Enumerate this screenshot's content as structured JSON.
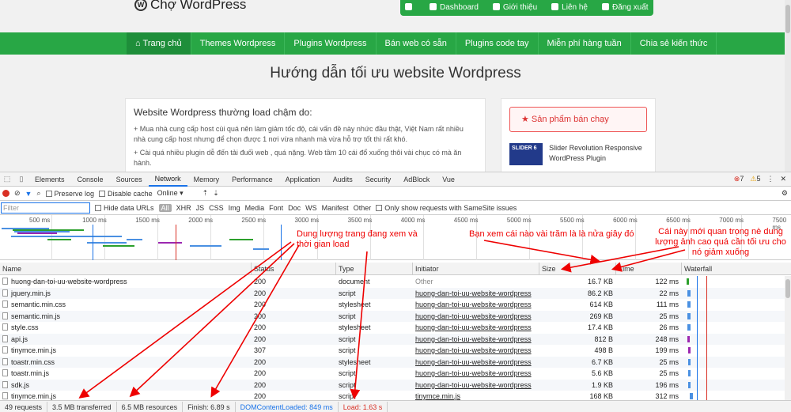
{
  "site": {
    "logo": "Chợ WordPress",
    "topnav": [
      "Dashboard",
      "Giới thiệu",
      "Liên hệ",
      "Đăng xuất"
    ],
    "mainnav": [
      "Trang chủ",
      "Themes Wordpress",
      "Plugins Wordpress",
      "Bán web có sẵn",
      "Plugins code tay",
      "Miễn phí hàng tuần",
      "Chia sẻ kiến thức"
    ],
    "heading": "Hướng dẫn tối ưu website Wordpress",
    "article_title": "Website Wordpress thường load chậm do:",
    "para1": "+ Mua nhà cung cấp host cùi quá nên làm giảm tốc độ, cái vấn đề này nhức đầu thật, Việt Nam rất nhiều nhà cung cấp host nhưng để chọn được 1 nơi vừa nhanh mà vừa hỗ trợ tốt thì rất khó.",
    "para2": "+ Cài quá nhiều plugin dễ đến tải đuối web , quá nặng. Web tầm 10 cái đổ xuống thôi vài chục có mà ăn hành.",
    "best_seller": "Sản phẩm bán chạy",
    "product_thumb": "SLIDER 6",
    "product_name": "Slider Revolution Responsive WordPress Plugin"
  },
  "devtools": {
    "tabs": [
      "Elements",
      "Console",
      "Sources",
      "Network",
      "Memory",
      "Performance",
      "Application",
      "Audits",
      "Security",
      "AdBlock",
      "Vue"
    ],
    "errors": "7",
    "warnings": "5",
    "preserve_log": "Preserve log",
    "disable_cache": "Disable cache",
    "throttle": "Online",
    "filter_placeholder": "Filter",
    "hide_data_urls": "Hide data URLs",
    "types": [
      "All",
      "XHR",
      "JS",
      "CSS",
      "Img",
      "Media",
      "Font",
      "Doc",
      "WS",
      "Manifest",
      "Other"
    ],
    "samesite": "Only show requests with SameSite issues",
    "ticks": [
      "500 ms",
      "1000 ms",
      "1500 ms",
      "2000 ms",
      "2500 ms",
      "3000 ms",
      "3500 ms",
      "4000 ms",
      "4500 ms",
      "5000 ms",
      "5500 ms",
      "6000 ms",
      "6500 ms",
      "7000 ms",
      "7500 ms"
    ],
    "columns": {
      "name": "Name",
      "status": "Status",
      "type": "Type",
      "initiator": "Initiator",
      "size": "Size",
      "time": "Time",
      "waterfall": "Waterfall"
    },
    "rows": [
      {
        "name": "huong-dan-toi-uu-website-wordpress",
        "status": "200",
        "type": "document",
        "initiator": "Other",
        "size": "16.7 KB",
        "time": "122 ms"
      },
      {
        "name": "jquery.min.js",
        "status": "200",
        "type": "script",
        "initiator": "huong-dan-toi-uu-website-wordpress",
        "size": "86.2 KB",
        "time": "22 ms"
      },
      {
        "name": "semantic.min.css",
        "status": "200",
        "type": "stylesheet",
        "initiator": "huong-dan-toi-uu-website-wordpress",
        "size": "614 KB",
        "time": "111 ms"
      },
      {
        "name": "semantic.min.js",
        "status": "200",
        "type": "script",
        "initiator": "huong-dan-toi-uu-website-wordpress",
        "size": "269 KB",
        "time": "25 ms"
      },
      {
        "name": "style.css",
        "status": "200",
        "type": "stylesheet",
        "initiator": "huong-dan-toi-uu-website-wordpress",
        "size": "17.4 KB",
        "time": "26 ms"
      },
      {
        "name": "api.js",
        "status": "200",
        "type": "script",
        "initiator": "huong-dan-toi-uu-website-wordpress",
        "size": "812 B",
        "time": "248 ms"
      },
      {
        "name": "tinymce.min.js",
        "status": "307",
        "type": "script",
        "initiator": "huong-dan-toi-uu-website-wordpress",
        "size": "498 B",
        "time": "199 ms"
      },
      {
        "name": "toastr.min.css",
        "status": "200",
        "type": "stylesheet",
        "initiator": "huong-dan-toi-uu-website-wordpress",
        "size": "6.7 KB",
        "time": "25 ms"
      },
      {
        "name": "toastr.min.js",
        "status": "200",
        "type": "script",
        "initiator": "huong-dan-toi-uu-website-wordpress",
        "size": "5.6 KB",
        "time": "25 ms"
      },
      {
        "name": "sdk.js",
        "status": "200",
        "type": "script",
        "initiator": "huong-dan-toi-uu-website-wordpress",
        "size": "1.9 KB",
        "time": "196 ms"
      },
      {
        "name": "tinymce.min.js",
        "status": "200",
        "type": "script",
        "initiator": "tinymce.min.js",
        "size": "168 KB",
        "time": "312 ms"
      }
    ],
    "status_bar": {
      "requests": "49 requests",
      "transferred": "3.5 MB transferred",
      "resources": "6.5 MB resources",
      "finish": "Finish: 6.89 s",
      "dcl": "DOMContentLoaded: 849 ms",
      "load": "Load: 1.63 s"
    }
  },
  "annotations": {
    "a1": "Dung lượng trang đang xem và thời gian load",
    "a2": "Bạn xem cái nào vài trăm là là nửa giây đó",
    "a3": "Cái này mới quan trọng nè dung lượng ảnh cao quá cần tối ưu cho nó giảm xuống"
  },
  "colors": {
    "green": "#28a745",
    "annotation": "#e00000",
    "devtools_blue": "#1a73e8"
  }
}
